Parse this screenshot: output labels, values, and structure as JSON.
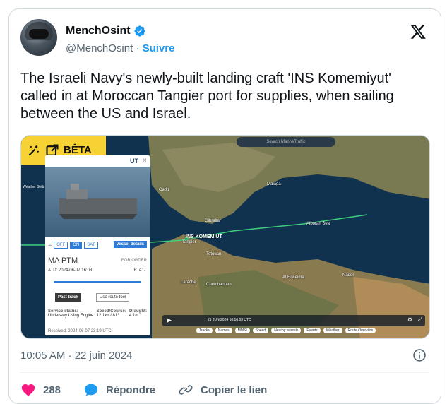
{
  "author": {
    "display_name": "MenchOsint",
    "handle": "@MenchOsint",
    "separator": "·",
    "follow_label": "Suivre"
  },
  "tweet": {
    "text": "The Israeli Navy's newly-built landing craft 'INS Komemiyut' called in at Moroccan Tangier port for supplies, when sailing between the US and Israel.",
    "timestamp": "10:05 AM · 22 juin 2024"
  },
  "media": {
    "beta_label": "BÊTA",
    "search_placeholder": "Search MarineTraffic",
    "weather_label": "Weather Settings",
    "ship_label": "INS KOMEMIUT",
    "panel": {
      "title_suffix": "UT",
      "toggle_off": "OFF",
      "toggle_on": "ON",
      "toggle_sat": "SAT",
      "vessel_details": "Vessel details",
      "destination": "MA PTM",
      "for_order": "FOR ORDER",
      "atd": "ATD: 2024-06-07 16:08",
      "eta": "ETA: -",
      "past_track": "Past track",
      "use_route_tool": "Use route tool",
      "service_label": "Service status:",
      "service_value": "Underway Using Engine",
      "speed_label": "Speed/Course:",
      "speed_value": "12.1kn / 81°",
      "draught_label": "Draught:",
      "draught_value": "4.1m",
      "received": "Received: 2024-06-07 23:19 UTC"
    },
    "places": [
      "Gibraltar",
      "Tangier",
      "Tetouan",
      "Alboran Sea",
      "Larache",
      "Al Hoceima",
      "Chefchaouen",
      "Nador",
      "Cadiz",
      "Malaga"
    ],
    "timeline_date": "21 JUN 2024 10:16:03 UTC",
    "chips": [
      "Tracks",
      "Names",
      "MMSI",
      "Speed",
      "Nearby vessels",
      "Events",
      "Weather",
      "Route Overview"
    ]
  },
  "actions": {
    "like_count": "288",
    "reply_label": "Répondre",
    "copy_link_label": "Copier le lien"
  },
  "colors": {
    "accent": "#1d9bf0",
    "like": "#f91880",
    "muted": "#536471",
    "beta": "#f7d234"
  }
}
